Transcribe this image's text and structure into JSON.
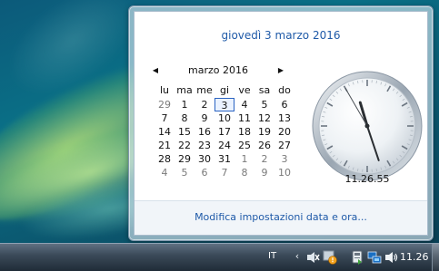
{
  "calendar_flyout": {
    "long_date": "giovedì 3 marzo 2016",
    "month_title": "marzo 2016",
    "weekdays": [
      "lu",
      "ma",
      "me",
      "gi",
      "ve",
      "sa",
      "do"
    ],
    "weeks": [
      [
        {
          "d": "29",
          "o": true
        },
        {
          "d": "1"
        },
        {
          "d": "2"
        },
        {
          "d": "3",
          "today": true
        },
        {
          "d": "4"
        },
        {
          "d": "5"
        },
        {
          "d": "6"
        }
      ],
      [
        {
          "d": "7"
        },
        {
          "d": "8"
        },
        {
          "d": "9"
        },
        {
          "d": "10"
        },
        {
          "d": "11"
        },
        {
          "d": "12"
        },
        {
          "d": "13"
        }
      ],
      [
        {
          "d": "14"
        },
        {
          "d": "15"
        },
        {
          "d": "16"
        },
        {
          "d": "17"
        },
        {
          "d": "18"
        },
        {
          "d": "19"
        },
        {
          "d": "20"
        }
      ],
      [
        {
          "d": "21"
        },
        {
          "d": "22"
        },
        {
          "d": "23"
        },
        {
          "d": "24"
        },
        {
          "d": "25"
        },
        {
          "d": "26"
        },
        {
          "d": "27"
        }
      ],
      [
        {
          "d": "28"
        },
        {
          "d": "29"
        },
        {
          "d": "30"
        },
        {
          "d": "31"
        },
        {
          "d": "1",
          "o": true
        },
        {
          "d": "2",
          "o": true
        },
        {
          "d": "3",
          "o": true
        }
      ],
      [
        {
          "d": "4",
          "o": true
        },
        {
          "d": "5",
          "o": true
        },
        {
          "d": "6",
          "o": true
        },
        {
          "d": "7",
          "o": true
        },
        {
          "d": "8",
          "o": true
        },
        {
          "d": "9",
          "o": true
        },
        {
          "d": "10",
          "o": true
        }
      ]
    ],
    "time": "11.26.55",
    "clock": {
      "hour": 11,
      "minute": 26,
      "second": 55
    },
    "settings_link": "Modifica impostazioni data e ora..."
  },
  "taskbar": {
    "language": "IT",
    "clock": "11.26",
    "tray_icons": [
      "expand-tray-icon",
      "speaker-muted-icon",
      "action-center-warning-icon",
      "usb-device-icon",
      "network-icon",
      "volume-icon"
    ]
  },
  "colors": {
    "link_blue": "#1f5aa8",
    "today_border": "#2a63c2"
  }
}
